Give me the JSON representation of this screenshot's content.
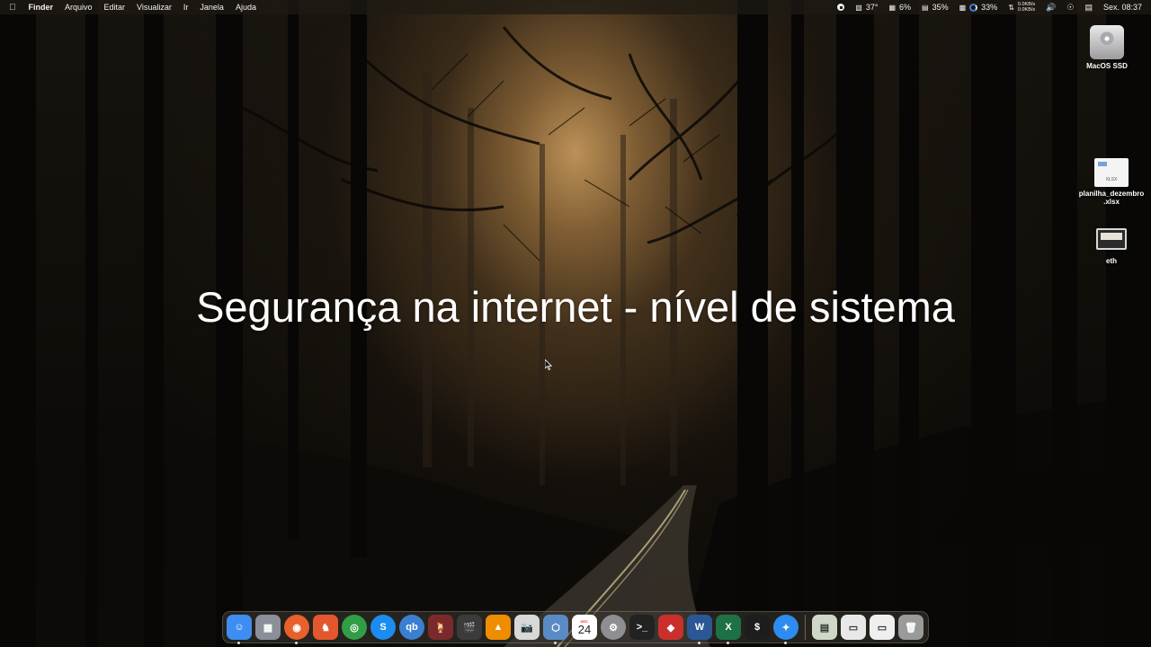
{
  "menubar": {
    "apple_icon": "apple-logo-icon",
    "app_name": "Finder",
    "menus": [
      "Arquivo",
      "Editar",
      "Visualizar",
      "Ir",
      "Janela",
      "Ajuda"
    ],
    "status": {
      "temperature": "37°",
      "cpu": "6%",
      "memory": "35%",
      "disk": "33%",
      "net_up": "0.0KB/s",
      "net_down": "0.0KB/s",
      "clock": "Sex. 08:37"
    }
  },
  "title": "Segurança na internet - nível de sistema",
  "desktop_icons": [
    {
      "label": "MacOS SSD",
      "icon": "hard-disk-icon"
    },
    {
      "label": "planilha_dezembro .xlsx",
      "icon": "spreadsheet-file-icon",
      "badge": "XLSX"
    },
    {
      "label": "eth",
      "icon": "screenshot-file-icon"
    }
  ],
  "dock": {
    "calendar": {
      "month": "DEZ.",
      "day": "24"
    },
    "apps": [
      {
        "name": "Finder",
        "icon": "finder-icon",
        "color": "#3d8ef0",
        "glyph": "☺",
        "running": true
      },
      {
        "name": "Launchpad",
        "icon": "launchpad-icon",
        "color": "#8a8f9a",
        "glyph": "▦",
        "running": false
      },
      {
        "name": "Firefox",
        "icon": "firefox-icon",
        "color": "#e8602c",
        "glyph": "◉",
        "running": true
      },
      {
        "name": "Brave",
        "icon": "brave-icon",
        "color": "#e4572e",
        "glyph": "♞",
        "running": false
      },
      {
        "name": "Chrome",
        "icon": "chrome-icon",
        "color": "#2f9e44",
        "glyph": "◎",
        "running": false
      },
      {
        "name": "Shazam",
        "icon": "shazam-icon",
        "color": "#1c8cf0",
        "glyph": "S",
        "running": false
      },
      {
        "name": "qBittorrent",
        "icon": "qbittorrent-icon",
        "color": "#3b7fd1",
        "glyph": "qb",
        "running": false
      },
      {
        "name": "Wine",
        "icon": "wine-icon",
        "color": "#7a2a2a",
        "glyph": "🍹",
        "running": false
      },
      {
        "name": "Final Cut Pro",
        "icon": "final-cut-pro-icon",
        "color": "#3b3b3b",
        "glyph": "🎬",
        "running": false
      },
      {
        "name": "VLC",
        "icon": "vlc-icon",
        "color": "#f08c00",
        "glyph": "▲",
        "running": false
      },
      {
        "name": "Screenshot",
        "icon": "screenshot-icon",
        "color": "#d8d8d8",
        "glyph": "📷",
        "running": false
      },
      {
        "name": "VirtualBox",
        "icon": "virtualbox-icon",
        "color": "#5a8bc4",
        "glyph": "⬡",
        "running": true
      },
      {
        "name": "Calendar",
        "icon": "calendar-icon",
        "color": "#ffffff",
        "glyph": "",
        "running": false
      },
      {
        "name": "System Preferences",
        "icon": "system-preferences-icon",
        "color": "#8e8e93",
        "glyph": "⚙",
        "running": false
      },
      {
        "name": "Terminal",
        "icon": "terminal-icon",
        "color": "#222222",
        "glyph": ">_",
        "running": false
      },
      {
        "name": "CrossOver",
        "icon": "crossover-icon",
        "color": "#c9302c",
        "glyph": "◆",
        "running": false
      },
      {
        "name": "Word",
        "icon": "word-icon",
        "color": "#2b5797",
        "glyph": "W",
        "running": true
      },
      {
        "name": "Excel",
        "icon": "excel-icon",
        "color": "#1e7145",
        "glyph": "X",
        "running": true
      },
      {
        "name": "Console",
        "icon": "console-icon",
        "color": "#1d1d1d",
        "glyph": "$",
        "running": false
      },
      {
        "name": "Safari",
        "icon": "safari-icon",
        "color": "#2d8cf0",
        "glyph": "✦",
        "running": true
      }
    ],
    "others": [
      {
        "name": "Downloads stack",
        "icon": "downloads-stack-icon",
        "color": "#cfd8c8",
        "glyph": "▤"
      },
      {
        "name": "Documents stack",
        "icon": "documents-stack-icon",
        "color": "#e8e8e8",
        "glyph": "▭"
      },
      {
        "name": "Files stack",
        "icon": "files-stack-icon",
        "color": "#efefef",
        "glyph": "▭"
      },
      {
        "name": "Trash",
        "icon": "trash-icon",
        "color": "#9a9a9a",
        "glyph": "🗑"
      }
    ]
  }
}
